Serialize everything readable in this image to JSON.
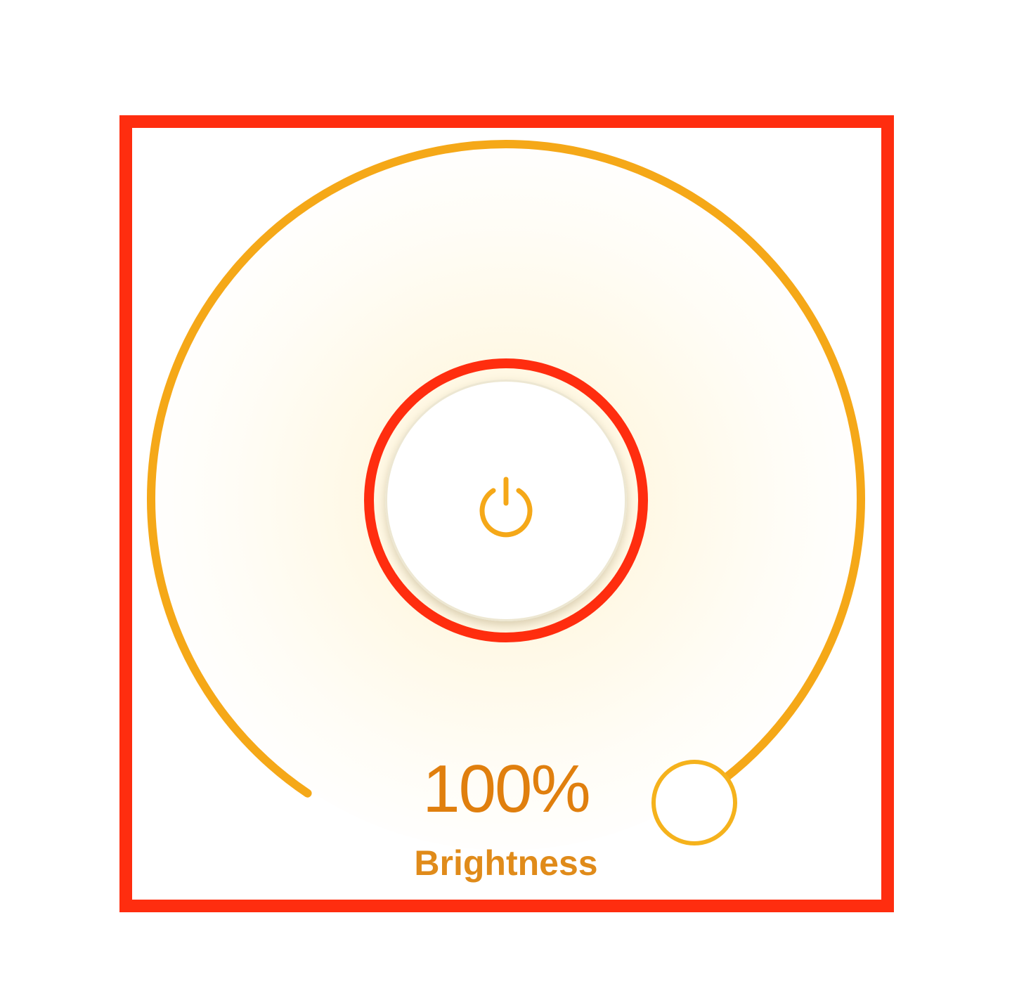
{
  "brightness": {
    "value_label": "100%",
    "caption": "Brightness",
    "level_percent": 100
  },
  "power": {
    "icon": "power-icon"
  },
  "colors": {
    "accent": "#f5a818",
    "highlight_frame": "#ff2d0f",
    "value_text": "#e07f0e",
    "caption_text": "#e08b1a"
  }
}
